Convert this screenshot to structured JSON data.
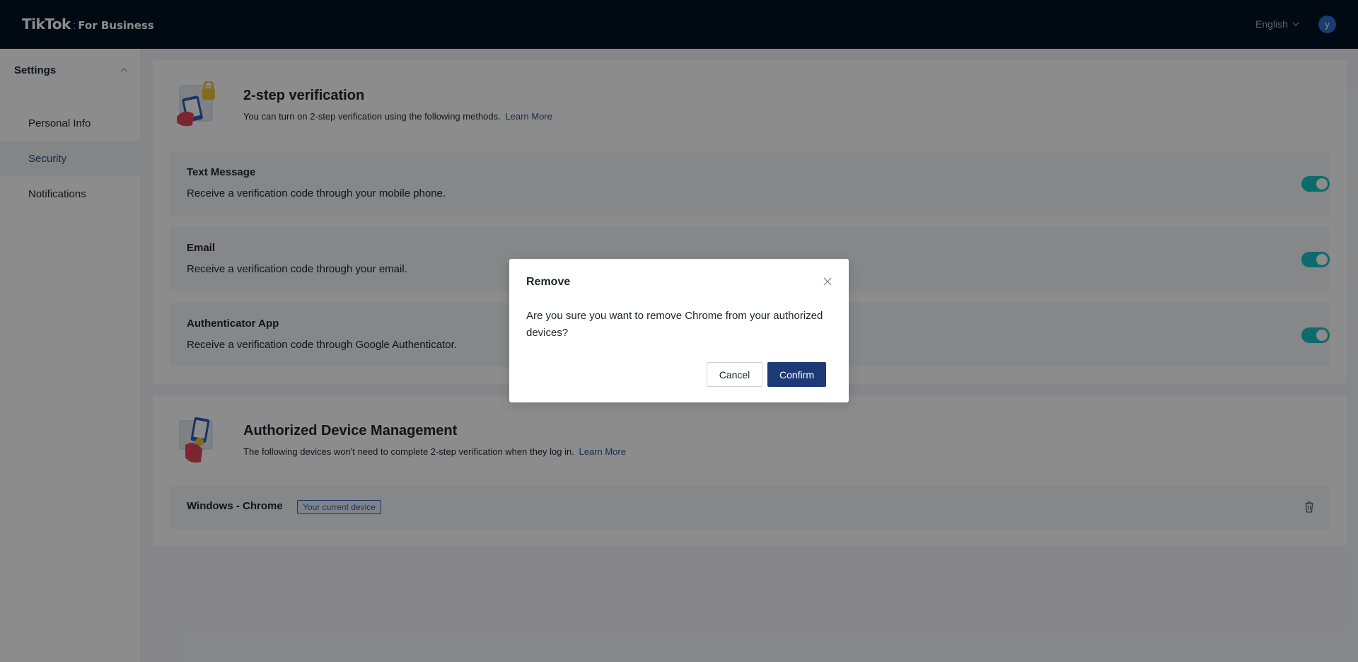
{
  "header": {
    "brand": "TikTok",
    "brand_separator": ":",
    "brand_sub": "For Business",
    "language": "English",
    "avatar_initial": "y"
  },
  "sidebar": {
    "title": "Settings",
    "items": [
      {
        "label": "Personal Info"
      },
      {
        "label": "Security"
      },
      {
        "label": "Notifications"
      }
    ]
  },
  "two_step": {
    "title": "2-step verification",
    "description": "You can turn on 2-step verification using the following methods.",
    "link": "Learn More",
    "methods": [
      {
        "name": "Text Message",
        "description": "Receive a verification code through your mobile phone.",
        "enabled": true
      },
      {
        "name": "Email",
        "description": "Receive a verification code through your email.",
        "enabled": true
      },
      {
        "name": "Authenticator App",
        "description": "Receive a verification code through Google Authenticator.",
        "enabled": true
      }
    ]
  },
  "devices": {
    "title": "Authorized Device Management",
    "description": "The following devices won't need to complete 2-step verification when they log in.",
    "link": "Learn More",
    "items": [
      {
        "name": "Windows - Chrome",
        "tag": "Your current device"
      }
    ]
  },
  "modal": {
    "title": "Remove",
    "body": "Are you sure you want to remove Chrome from your authorized devices?",
    "cancel_label": "Cancel",
    "confirm_label": "Confirm"
  },
  "colors": {
    "topbar": "#021124",
    "accent": "#1e3a76",
    "toggle_on": "#17c3c3",
    "link": "#2f4f8f"
  }
}
